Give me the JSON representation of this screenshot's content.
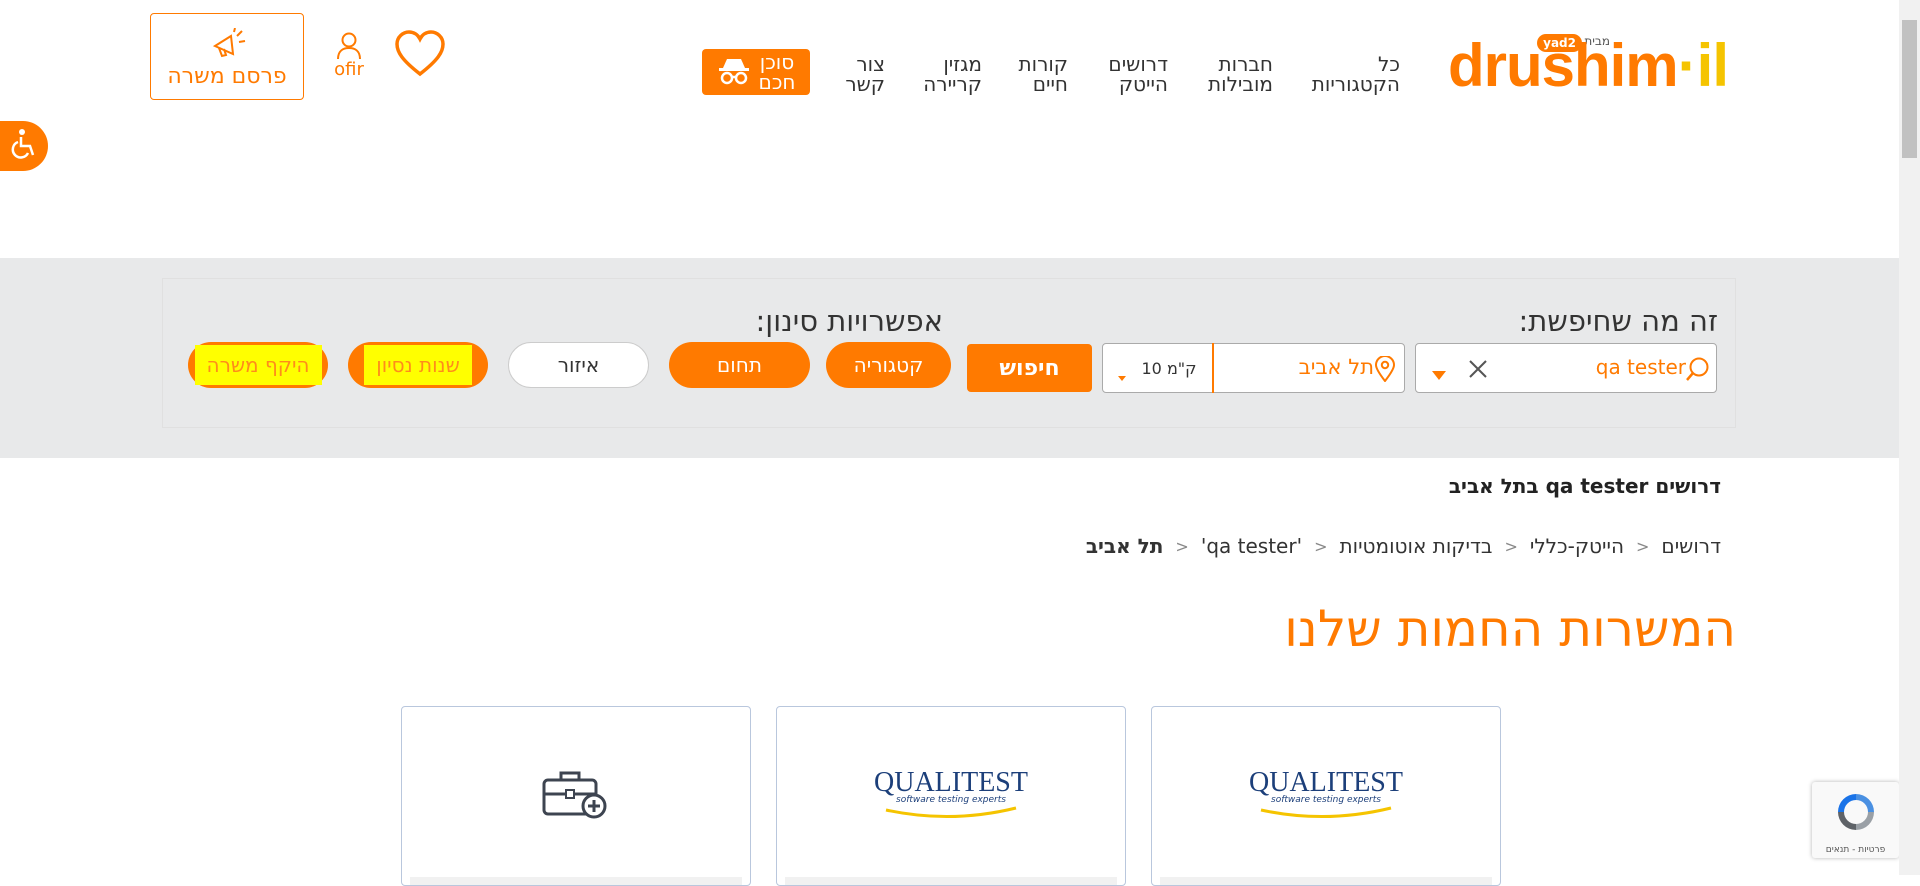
{
  "logo": {
    "text_main": "drushim",
    "text_tld": "il",
    "from_label": "מבית",
    "yad2": "yad2"
  },
  "nav": {
    "all_categories": [
      "כל",
      "הקטגוריות"
    ],
    "leading_companies": [
      "חברות",
      "מובילות"
    ],
    "hitech_jobs": [
      "דרושים",
      "הייטק"
    ],
    "cv": [
      "קורות",
      "חיים"
    ],
    "career_magazine": [
      "מגזין",
      "קריירה"
    ],
    "contact": [
      "צור",
      "קשר"
    ],
    "smart_agent": [
      "סוכן",
      "חכם"
    ]
  },
  "header": {
    "user_name": "ofir",
    "post_job": "פרסם משרה"
  },
  "search": {
    "label_searched": "זה מה שחיפשת:",
    "label_filters": "אפשרויות סינון:",
    "query": "qa tester",
    "location": "תל אביב",
    "radius": "10 ק\"מ",
    "search_button": "חיפוש"
  },
  "filters": {
    "category": "קטגוריה",
    "field": "תחום",
    "area": "איזור",
    "experience": "שנות נסיון",
    "scope": "היקף משרה"
  },
  "results": {
    "title": "דרושים qa tester בתל אביב",
    "breadcrumbs": [
      "דרושים",
      "הייטק-כללי",
      "בדיקות אוטומטיות",
      "'qa tester'",
      "תל אביב"
    ]
  },
  "hot_jobs": {
    "title": "המשרות החמות שלנו",
    "cards": [
      {
        "company": "QUALITEST",
        "tagline": "software testing experts"
      },
      {
        "company": "QUALITEST",
        "tagline": "software testing experts"
      },
      {
        "company": "",
        "tagline": ""
      }
    ]
  },
  "recaptcha": {
    "footer": "פרטיות - תנאים"
  },
  "colors": {
    "brand": "#ff7a00",
    "accent_yellow": "#f5c400",
    "band": "#e8e9ea"
  }
}
